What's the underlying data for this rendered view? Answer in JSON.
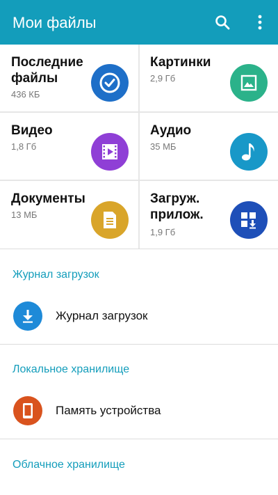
{
  "app": {
    "title": "Мои файлы"
  },
  "tiles": [
    {
      "name": "Последние файлы",
      "size": "436 КБ",
      "icon": "clock-icon",
      "color": "#1e6fc8"
    },
    {
      "name": "Картинки",
      "size": "2,9 Гб",
      "icon": "image-icon",
      "color": "#2bb28a"
    },
    {
      "name": "Видео",
      "size": "1,8 Гб",
      "icon": "video-icon",
      "color": "#8f3fd6"
    },
    {
      "name": "Аудио",
      "size": "35 МБ",
      "icon": "music-note-icon",
      "color": "#1898c8"
    },
    {
      "name": "Документы",
      "size": "13 МБ",
      "icon": "document-icon",
      "color": "#d9a52a"
    },
    {
      "name": "Загруж. прилож.",
      "size": "1,9 Гб",
      "icon": "apps-download-icon",
      "color": "#1e4fb8"
    }
  ],
  "sections": [
    {
      "title": "Журнал загрузок",
      "item": {
        "label": "Журнал загрузок",
        "icon": "download-icon",
        "color": "#1e8ad8"
      }
    },
    {
      "title": "Локальное хранилище",
      "item": {
        "label": "Память устройства",
        "icon": "phone-icon",
        "color": "#d9531e"
      }
    },
    {
      "title": "Облачное хранилище"
    }
  ],
  "colors": {
    "accent": "#139dbb"
  }
}
